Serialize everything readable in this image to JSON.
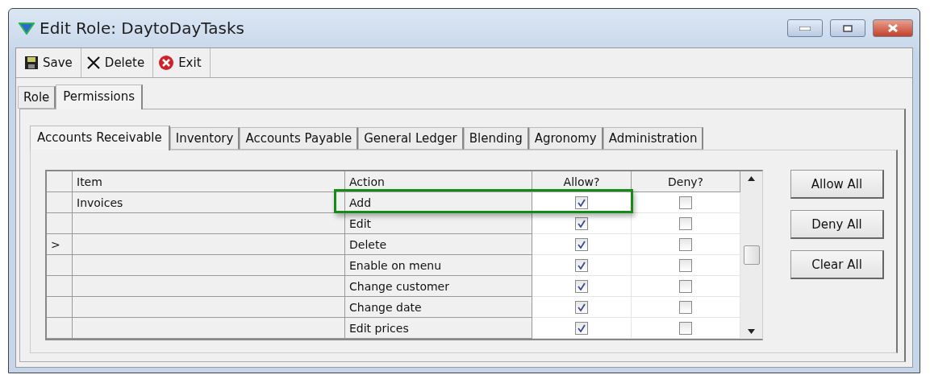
{
  "window": {
    "title": "Edit Role: DaytoDayTasks"
  },
  "toolbar": [
    {
      "kind": "save",
      "label": "Save"
    },
    {
      "kind": "delete",
      "label": "Delete"
    },
    {
      "kind": "exit",
      "label": "Exit"
    }
  ],
  "tabs": [
    {
      "label": "Role",
      "selected": false
    },
    {
      "label": "Permissions",
      "selected": true
    }
  ],
  "subtabs": [
    {
      "label": "Accounts Receivable",
      "selected": true
    },
    {
      "label": "Inventory",
      "selected": false
    },
    {
      "label": "Accounts Payable",
      "selected": false
    },
    {
      "label": "General Ledger",
      "selected": false
    },
    {
      "label": "Blending",
      "selected": false
    },
    {
      "label": "Agronomy",
      "selected": false
    },
    {
      "label": "Administration",
      "selected": false
    }
  ],
  "table": {
    "columns": [
      "Item",
      "Action",
      "Allow?",
      "Deny?"
    ],
    "rows": [
      {
        "current": false,
        "item": "Invoices",
        "action": "Add",
        "allow": true,
        "deny": false,
        "highlighted": true
      },
      {
        "current": false,
        "action": "Edit",
        "allow": true,
        "deny": false,
        "highlighted": false
      },
      {
        "current": true,
        "marker": ">",
        "action": "Delete",
        "allow": true,
        "deny": false,
        "highlighted": false
      },
      {
        "current": false,
        "action": "Enable on menu",
        "allow": true,
        "deny": false,
        "highlighted": false
      },
      {
        "current": false,
        "action": "Change customer",
        "allow": true,
        "deny": false,
        "highlighted": false
      },
      {
        "current": false,
        "action": "Change date",
        "allow": true,
        "deny": false,
        "highlighted": false
      },
      {
        "current": false,
        "action": "Edit prices",
        "allow": true,
        "deny": false,
        "highlighted": false
      }
    ]
  },
  "buttons": [
    "Allow All",
    "Deny All",
    "Clear All"
  ]
}
